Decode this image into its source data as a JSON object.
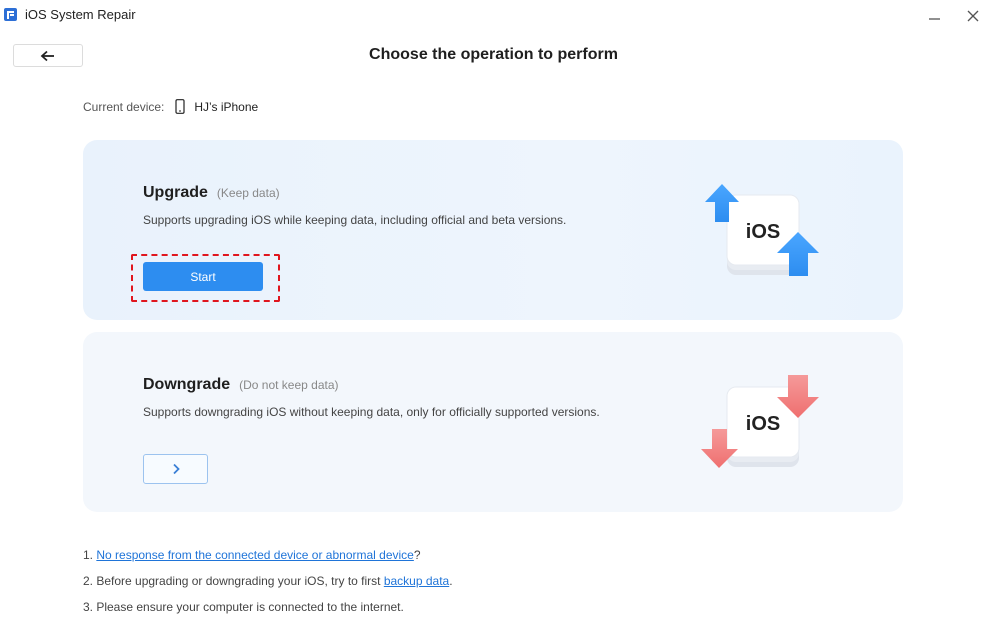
{
  "window": {
    "title": "iOS System Repair",
    "minimize_icon": "minimize-icon",
    "close_icon": "close-icon"
  },
  "header": {
    "back_icon": "arrow-left-icon",
    "title": "Choose the operation to perform"
  },
  "device": {
    "label": "Current device:",
    "icon": "phone-icon",
    "name": "HJ’s iPhone"
  },
  "upgrade": {
    "title": "Upgrade",
    "tag": "(Keep data)",
    "description": "Supports upgrading iOS while keeping data, including official and beta versions.",
    "button_label": "Start",
    "illustration_text": "iOS",
    "accent_color": "#2d8df0"
  },
  "downgrade": {
    "title": "Downgrade",
    "tag": "(Do not keep data)",
    "description": "Supports downgrading iOS without keeping data, only for officially supported versions.",
    "button_icon": "chevron-right-icon",
    "illustration_text": "iOS",
    "accent_color": "#f27b7b"
  },
  "notes": {
    "n1_prefix": "1. ",
    "n1_link": "No response from the connected device or abnormal device",
    "n1_suffix": "?",
    "n2_prefix": "2. Before upgrading or downgrading your iOS, try to first ",
    "n2_link": "backup data",
    "n2_suffix": ".",
    "n3": "3. Please ensure your computer is connected to the internet."
  }
}
